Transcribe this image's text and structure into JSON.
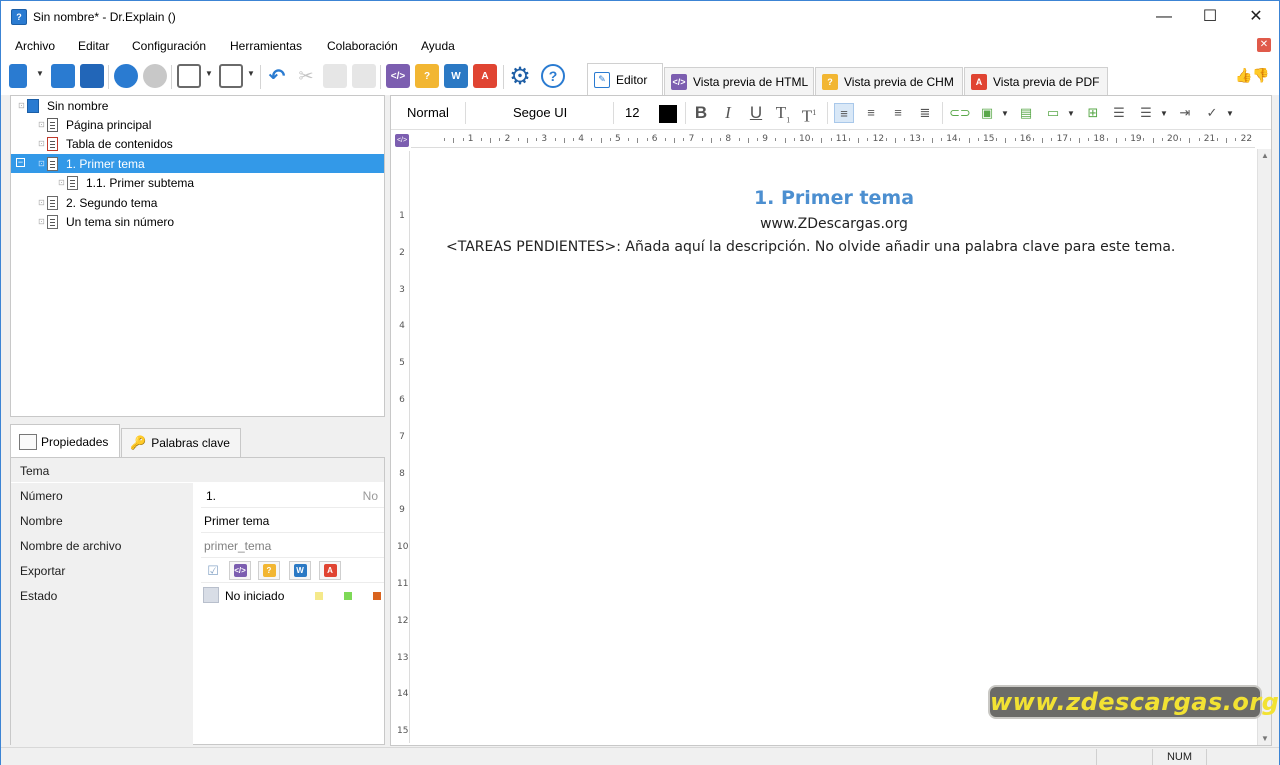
{
  "window": {
    "title": "Sin nombre* - Dr.Explain ()",
    "app_icon_text": "?",
    "controls": {
      "minimize": "—",
      "maximize": "☐",
      "close": "✕"
    }
  },
  "menu": {
    "items": [
      "Archivo",
      "Editar",
      "Configuración",
      "Herramientas",
      "Colaboración",
      "Ayuda"
    ],
    "close_glyph": "✕"
  },
  "view_tabs": [
    {
      "label": "Editor",
      "icon": "pencil-icon",
      "active": true
    },
    {
      "label": "Vista previa de HTML",
      "icon": "html-icon",
      "active": false
    },
    {
      "label": "Vista previa de CHM",
      "icon": "chm-icon",
      "active": false
    },
    {
      "label": "Vista previa de PDF",
      "icon": "pdf-icon",
      "active": false
    }
  ],
  "tree": {
    "items": [
      {
        "label": "Sin nombre",
        "icon": "book-icon",
        "level": 0
      },
      {
        "label": "Página principal",
        "icon": "home-page-icon",
        "level": 1
      },
      {
        "label": "Tabla de contenidos",
        "icon": "toc-icon",
        "level": 1
      },
      {
        "label": "1. Primer tema",
        "icon": "page-icon",
        "level": 1,
        "selected": true
      },
      {
        "label": "1.1. Primer subtema",
        "icon": "page-icon",
        "level": 2
      },
      {
        "label": "2. Segundo tema",
        "icon": "page-icon",
        "level": 1
      },
      {
        "label": "Un tema sin número",
        "icon": "page-icon",
        "level": 1
      }
    ]
  },
  "properties": {
    "tabs": [
      {
        "label": "Propiedades",
        "icon": "properties-icon",
        "active": true
      },
      {
        "label": "Palabras clave",
        "icon": "key-icon",
        "active": false
      }
    ],
    "header": "Tema",
    "rows": {
      "numero": {
        "label": "Número",
        "value": "1.",
        "extra": "No"
      },
      "nombre": {
        "label": "Nombre",
        "value": "Primer tema"
      },
      "archivo": {
        "label": "Nombre de archivo",
        "value": "primer_tema"
      },
      "exportar": {
        "label": "Exportar"
      },
      "estado": {
        "label": "Estado",
        "value": "No iniciado"
      }
    }
  },
  "format_bar": {
    "style": "Normal",
    "font": "Segoe UI",
    "size": "12",
    "text_color": "#000000"
  },
  "ruler": {
    "h_ticks": [
      "1",
      "2",
      "3",
      "4",
      "5",
      "6",
      "7",
      "8",
      "9",
      "10",
      "11",
      "12",
      "13",
      "14",
      "15",
      "16",
      "17",
      "18",
      "19",
      "20",
      "21",
      "22"
    ],
    "v_ticks": [
      "1",
      "2",
      "3",
      "4",
      "5",
      "6",
      "7",
      "8",
      "9",
      "10",
      "11",
      "12",
      "13",
      "14",
      "15"
    ]
  },
  "document": {
    "title": "1. Primer tema",
    "subtitle": "www.ZDescargas.org",
    "body": "<TAREAS PENDIENTES>: Añada aquí la descripción. No olvide añadir una palabra clave para este tema."
  },
  "watermark": "www.zdescargas.org",
  "statusbar": {
    "num": "NUM"
  },
  "colors": {
    "accent": "#3399e8",
    "title_blue": "#4c8fd0",
    "status_yellow": "#f5e98a",
    "status_green": "#7ed957",
    "status_orange": "#d9631e"
  }
}
